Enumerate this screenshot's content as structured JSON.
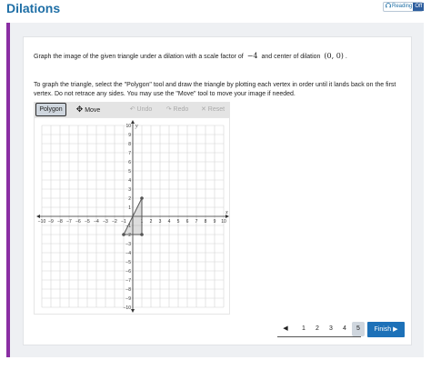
{
  "header": {
    "title": "Dilations",
    "reading_label": "Reading",
    "reading_state": "Off"
  },
  "question": {
    "prefix": "Graph the image of the given triangle under a dilation with a scale factor of",
    "scale": "−4",
    "middle": "and center of dilation",
    "center": "(0, 0)",
    "suffix": "."
  },
  "instructions": "To graph the triangle, select the \"Polygon\" tool and draw the triangle by plotting each vertex in order until it lands back on the first vertex. Do not retrace any sides. You may use the \"Move\" tool to move your image if needed.",
  "toolbar": {
    "polygon": "Polygon",
    "move": "Move",
    "undo": "Undo",
    "redo": "Redo",
    "reset": "Reset"
  },
  "graph": {
    "x_label": "x",
    "y_label": "y",
    "x_ticks": [
      "−10",
      "−9",
      "−8",
      "−7",
      "−6",
      "−5",
      "−4",
      "−3",
      "−2",
      "−1",
      "1",
      "2",
      "3",
      "4",
      "5",
      "6",
      "7",
      "8",
      "9",
      "10"
    ],
    "y_ticks": [
      "10",
      "9",
      "8",
      "7",
      "6",
      "5",
      "4",
      "3",
      "2",
      "1",
      "−1",
      "−2",
      "−3",
      "−4",
      "−5",
      "−6",
      "−7",
      "−8",
      "−9",
      "−10"
    ],
    "triangle": [
      [
        -1,
        -2
      ],
      [
        1,
        2
      ],
      [
        1,
        -2
      ]
    ],
    "xlim": [
      -10,
      10
    ],
    "ylim": [
      -10,
      10
    ]
  },
  "pager": {
    "pages": [
      "1",
      "2",
      "3",
      "4",
      "5"
    ],
    "current": "5",
    "finish": "Finish"
  },
  "colors": {
    "title": "#1f6fa6",
    "accent": "#8a2ea3",
    "finish": "#1d71b8",
    "triangle": "#555555"
  }
}
